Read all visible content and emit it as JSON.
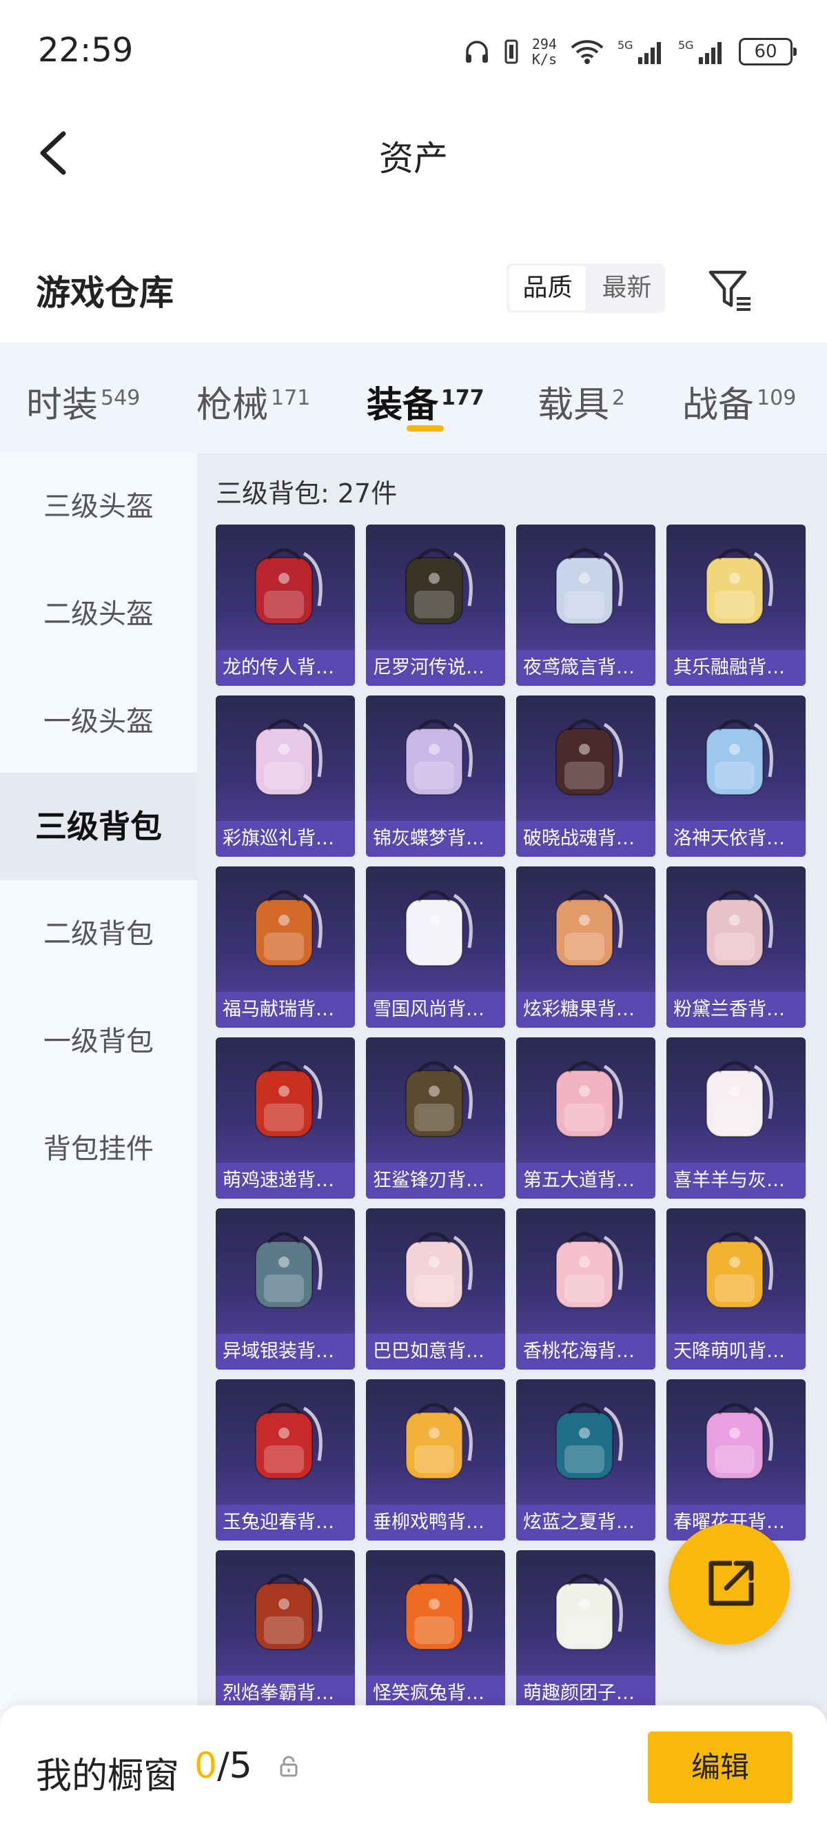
{
  "status": {
    "time": "22:59",
    "net_speed_value": "294",
    "net_speed_unit": "K/s",
    "battery": "60"
  },
  "nav": {
    "title": "资产"
  },
  "section": {
    "title": "游戏仓库",
    "sort_options": [
      "品质",
      "最新"
    ],
    "active_sort": "品质"
  },
  "tabs": [
    {
      "label": "时装",
      "count": "549"
    },
    {
      "label": "枪械",
      "count": "171"
    },
    {
      "label": "装备",
      "count": "177"
    },
    {
      "label": "载具",
      "count": "2"
    },
    {
      "label": "战备",
      "count": "109"
    }
  ],
  "active_tab": "装备",
  "sidebar": {
    "items": [
      "三级头盔",
      "二级头盔",
      "一级头盔",
      "三级背包",
      "二级背包",
      "一级背包",
      "背包挂件"
    ],
    "active": "三级背包"
  },
  "content": {
    "header": "三级背包: 27件",
    "items": [
      {
        "name": "龙的传人背包...",
        "icon": "backpack-red-icon",
        "color": "#b8252f"
      },
      {
        "name": "尼罗河传说背...",
        "icon": "backpack-pharaoh-icon",
        "color": "#3a3428"
      },
      {
        "name": "夜鸢箴言背包...",
        "icon": "backpack-jellyfish-icon",
        "color": "#c8d4e8"
      },
      {
        "name": "其乐融融背包...",
        "icon": "backpack-plush-icon",
        "color": "#f2d67a"
      },
      {
        "name": "彩旗巡礼背包...",
        "icon": "backpack-ornament-icon",
        "color": "#e8c8e8"
      },
      {
        "name": "锦灰蝶梦背包...",
        "icon": "backpack-butterfly-icon",
        "color": "#c9b7e8"
      },
      {
        "name": "破晓战魂背包...",
        "icon": "backpack-spiked-icon",
        "color": "#4a2a2a"
      },
      {
        "name": "洛神天依背包...",
        "icon": "backpack-fairy-icon",
        "color": "#9ec7ee"
      },
      {
        "name": "福马献瑞背包...",
        "icon": "backpack-horse-icon",
        "color": "#d36a2a"
      },
      {
        "name": "雪国风尚背包...",
        "icon": "backpack-penguin-icon",
        "color": "#f3f3f8"
      },
      {
        "name": "炫彩糖果背包...",
        "icon": "backpack-donut-icon",
        "color": "#e39a6a"
      },
      {
        "name": "粉黛兰香背包...",
        "icon": "backpack-pink-round-icon",
        "color": "#e8c2c8"
      },
      {
        "name": "萌鸡速递背包...",
        "icon": "backpack-chick-icon",
        "color": "#c93020"
      },
      {
        "name": "狂鲨锋刃背包...",
        "icon": "backpack-shark-icon",
        "color": "#5a4a30"
      },
      {
        "name": "第五大道背包...",
        "icon": "backpack-quilted-icon",
        "color": "#f2b4c4"
      },
      {
        "name": "喜羊羊与灰太...",
        "icon": "backpack-sheep-icon",
        "color": "#f6eef2"
      },
      {
        "name": "异域银装背包...",
        "icon": "backpack-tactical-icon",
        "color": "#5a7a88"
      },
      {
        "name": "巴巴如意背包...",
        "icon": "backpack-bunny-icon",
        "color": "#f2d4d8"
      },
      {
        "name": "香桃花海背包...",
        "icon": "backpack-peach-icon",
        "color": "#f4c0cc"
      },
      {
        "name": "天降萌叽背包...",
        "icon": "backpack-yellow-icon",
        "color": "#f2b232"
      },
      {
        "name": "玉兔迎春背包...",
        "icon": "backpack-red-white-icon",
        "color": "#c82a2a"
      },
      {
        "name": "垂柳戏鸭背包...",
        "icon": "backpack-duck-icon",
        "color": "#f2b03a"
      },
      {
        "name": "炫蓝之夏背包...",
        "icon": "backpack-blue-icon",
        "color": "#1f6f8a"
      },
      {
        "name": "春曜花开背包...",
        "icon": "backpack-wings-icon",
        "color": "#e8a0e0"
      },
      {
        "name": "烈焰拳霸背包...",
        "icon": "backpack-fire-icon",
        "color": "#a83820"
      },
      {
        "name": "怪笑疯兔背包...",
        "icon": "backpack-clown-icon",
        "color": "#ee6a20"
      },
      {
        "name": "萌趣颜团子背...",
        "icon": "backpack-sprout-icon",
        "color": "#eef2e8"
      }
    ]
  },
  "bottom": {
    "showcase_label": "我的橱窗",
    "current": "0",
    "total": "/5",
    "edit_label": "编辑"
  },
  "colors": {
    "accent": "#f8b90c",
    "card_label_bg": "#5b47b0"
  }
}
